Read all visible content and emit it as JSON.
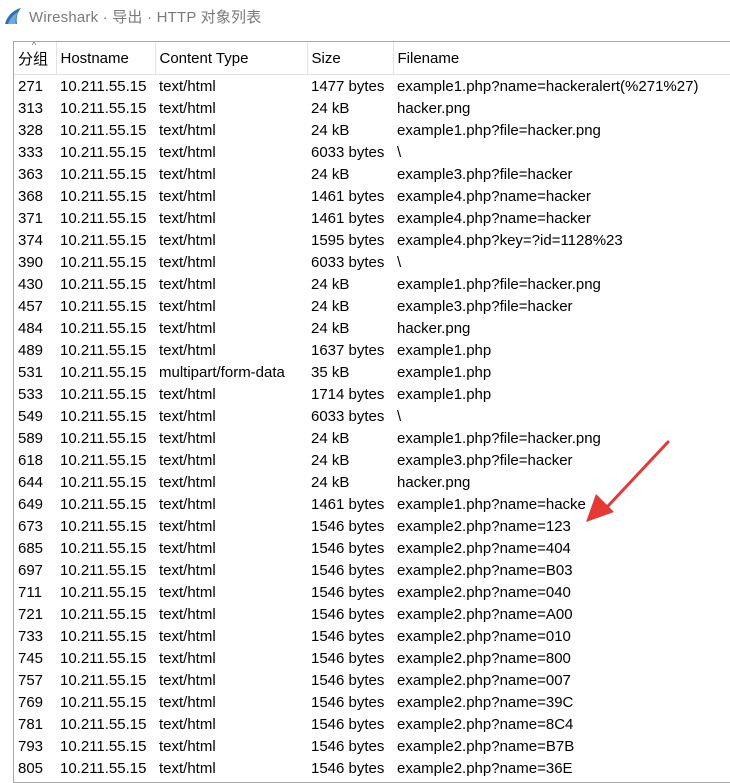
{
  "window": {
    "title": "Wireshark · 导出 · HTTP 对象列表"
  },
  "columns": [
    "分组",
    "Hostname",
    "Content Type",
    "Size",
    "Filename"
  ],
  "rows": [
    [
      "271",
      "10.211.55.15",
      "text/html",
      "1477 bytes",
      "example1.php?name=hackeralert(%271%27)"
    ],
    [
      "313",
      "10.211.55.15",
      "text/html",
      "24 kB",
      "hacker.png"
    ],
    [
      "328",
      "10.211.55.15",
      "text/html",
      "24 kB",
      "example1.php?file=hacker.png"
    ],
    [
      "333",
      "10.211.55.15",
      "text/html",
      "6033 bytes",
      "\\"
    ],
    [
      "363",
      "10.211.55.15",
      "text/html",
      "24 kB",
      "example3.php?file=hacker"
    ],
    [
      "368",
      "10.211.55.15",
      "text/html",
      "1461 bytes",
      "example4.php?name=hacker"
    ],
    [
      "371",
      "10.211.55.15",
      "text/html",
      "1461 bytes",
      "example4.php?name=hacker"
    ],
    [
      "374",
      "10.211.55.15",
      "text/html",
      "1595 bytes",
      "example4.php?key=?id=1128%23"
    ],
    [
      "390",
      "10.211.55.15",
      "text/html",
      "6033 bytes",
      "\\"
    ],
    [
      "430",
      "10.211.55.15",
      "text/html",
      "24 kB",
      "example1.php?file=hacker.png"
    ],
    [
      "457",
      "10.211.55.15",
      "text/html",
      "24 kB",
      "example3.php?file=hacker"
    ],
    [
      "484",
      "10.211.55.15",
      "text/html",
      "24 kB",
      "hacker.png"
    ],
    [
      "489",
      "10.211.55.15",
      "text/html",
      "1637 bytes",
      "example1.php"
    ],
    [
      "531",
      "10.211.55.15",
      "multipart/form-data",
      "35 kB",
      "example1.php"
    ],
    [
      "533",
      "10.211.55.15",
      "text/html",
      "1714 bytes",
      "example1.php"
    ],
    [
      "549",
      "10.211.55.15",
      "text/html",
      "6033 bytes",
      "\\"
    ],
    [
      "589",
      "10.211.55.15",
      "text/html",
      "24 kB",
      "example1.php?file=hacker.png"
    ],
    [
      "618",
      "10.211.55.15",
      "text/html",
      "24 kB",
      "example3.php?file=hacker"
    ],
    [
      "644",
      "10.211.55.15",
      "text/html",
      "24 kB",
      "hacker.png"
    ],
    [
      "649",
      "10.211.55.15",
      "text/html",
      "1461 bytes",
      "example1.php?name=hacke"
    ],
    [
      "673",
      "10.211.55.15",
      "text/html",
      "1546 bytes",
      "example2.php?name=123"
    ],
    [
      "685",
      "10.211.55.15",
      "text/html",
      "1546 bytes",
      "example2.php?name=404"
    ],
    [
      "697",
      "10.211.55.15",
      "text/html",
      "1546 bytes",
      "example2.php?name=B03"
    ],
    [
      "711",
      "10.211.55.15",
      "text/html",
      "1546 bytes",
      "example2.php?name=040"
    ],
    [
      "721",
      "10.211.55.15",
      "text/html",
      "1546 bytes",
      "example2.php?name=A00"
    ],
    [
      "733",
      "10.211.55.15",
      "text/html",
      "1546 bytes",
      "example2.php?name=010"
    ],
    [
      "745",
      "10.211.55.15",
      "text/html",
      "1546 bytes",
      "example2.php?name=800"
    ],
    [
      "757",
      "10.211.55.15",
      "text/html",
      "1546 bytes",
      "example2.php?name=007"
    ],
    [
      "769",
      "10.211.55.15",
      "text/html",
      "1546 bytes",
      "example2.php?name=39C"
    ],
    [
      "781",
      "10.211.55.15",
      "text/html",
      "1546 bytes",
      "example2.php?name=8C4"
    ],
    [
      "793",
      "10.211.55.15",
      "text/html",
      "1546 bytes",
      "example2.php?name=B7B"
    ],
    [
      "805",
      "10.211.55.15",
      "text/html",
      "1546 bytes",
      "example2.php?name=36E"
    ]
  ],
  "colors": {
    "annotation_arrow": "#e53935",
    "app_icon": "#2f6fb3"
  },
  "icons": {
    "app": "wireshark-fin-icon",
    "sort": "sort-ascending-icon",
    "annotation": "red-arrow-annotation"
  }
}
